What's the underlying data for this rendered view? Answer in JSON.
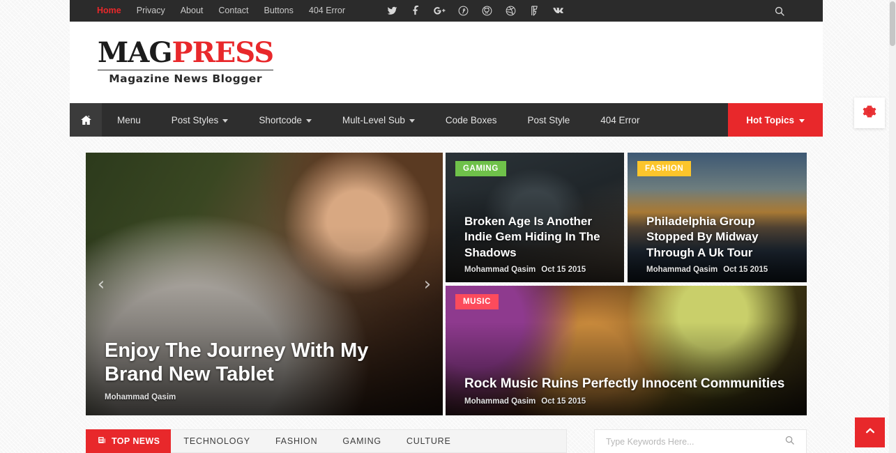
{
  "topbar": {
    "nav": [
      {
        "label": "Home",
        "active": true
      },
      {
        "label": "Privacy",
        "active": false
      },
      {
        "label": "About",
        "active": false
      },
      {
        "label": "Contact",
        "active": false
      },
      {
        "label": "Buttons",
        "active": false
      },
      {
        "label": "404 Error",
        "active": false
      }
    ],
    "social": [
      {
        "name": "twitter-icon"
      },
      {
        "name": "facebook-icon"
      },
      {
        "name": "google-plus-icon"
      },
      {
        "name": "pinterest-icon"
      },
      {
        "name": "github-icon"
      },
      {
        "name": "dribbble-icon"
      },
      {
        "name": "foursquare-icon"
      },
      {
        "name": "vk-icon"
      }
    ],
    "search_icon": "search-icon",
    "background": "#2b2b2b"
  },
  "logo": {
    "part1": "MAG",
    "part2": "PRESS",
    "tagline": "Magazine News Blogger",
    "color_dark": "#1c1c1c",
    "color_accent": "#e8282b"
  },
  "mainnav": {
    "home_icon": "home-icon",
    "items": [
      {
        "label": "Menu",
        "caret": false
      },
      {
        "label": "Post Styles",
        "caret": true
      },
      {
        "label": "Shortcode",
        "caret": true
      },
      {
        "label": "Mult-Level Sub",
        "caret": true
      },
      {
        "label": "Code Boxes",
        "caret": false
      },
      {
        "label": "Post Style",
        "caret": false
      },
      {
        "label": "404 Error",
        "caret": false
      }
    ],
    "hot_topics": {
      "label": "Hot Topics",
      "caret": true,
      "color": "#e8282b"
    },
    "background": "#2e2e2e"
  },
  "featured": {
    "hero": {
      "title": "Enjoy The Journey With My Brand New Tablet",
      "author": "Mohammad Qasim",
      "date": "",
      "prev_arrow": "‹",
      "next_arrow": "›"
    },
    "gaming": {
      "badge": "GAMING",
      "badge_color": "#6fc14a",
      "title": "Broken Age Is Another Indie Gem Hiding In The Shadows",
      "author": "Mohammad Qasim",
      "date": "Oct 15 2015"
    },
    "fashion": {
      "badge": "FASHION",
      "badge_color": "#fcc52b",
      "title": "Philadelphia Group Stopped By Midway Through A Uk Tour",
      "author": "Mohammad Qasim",
      "date": "Oct 15 2015"
    },
    "music": {
      "badge": "MUSIC",
      "badge_color": "#fc4b5c",
      "title": "Rock Music Ruins Perfectly Innocent Communities",
      "author": "Mohammad Qasim",
      "date": "Oct 15 2015"
    }
  },
  "tabs": {
    "active": {
      "label": "TOP NEWS",
      "icon": "newspaper-icon",
      "color": "#e8282b"
    },
    "items": [
      {
        "label": "TECHNOLOGY"
      },
      {
        "label": "FASHION"
      },
      {
        "label": "GAMING"
      },
      {
        "label": "CULTURE"
      }
    ]
  },
  "search": {
    "placeholder": "Type Keywords Here...",
    "value": "",
    "icon": "search-icon"
  },
  "widgets": {
    "gear": {
      "icon": "gear-icon",
      "color": "#e8282b"
    },
    "to_top": {
      "icon": "chevron-up-icon",
      "color": "#e8282b"
    }
  }
}
